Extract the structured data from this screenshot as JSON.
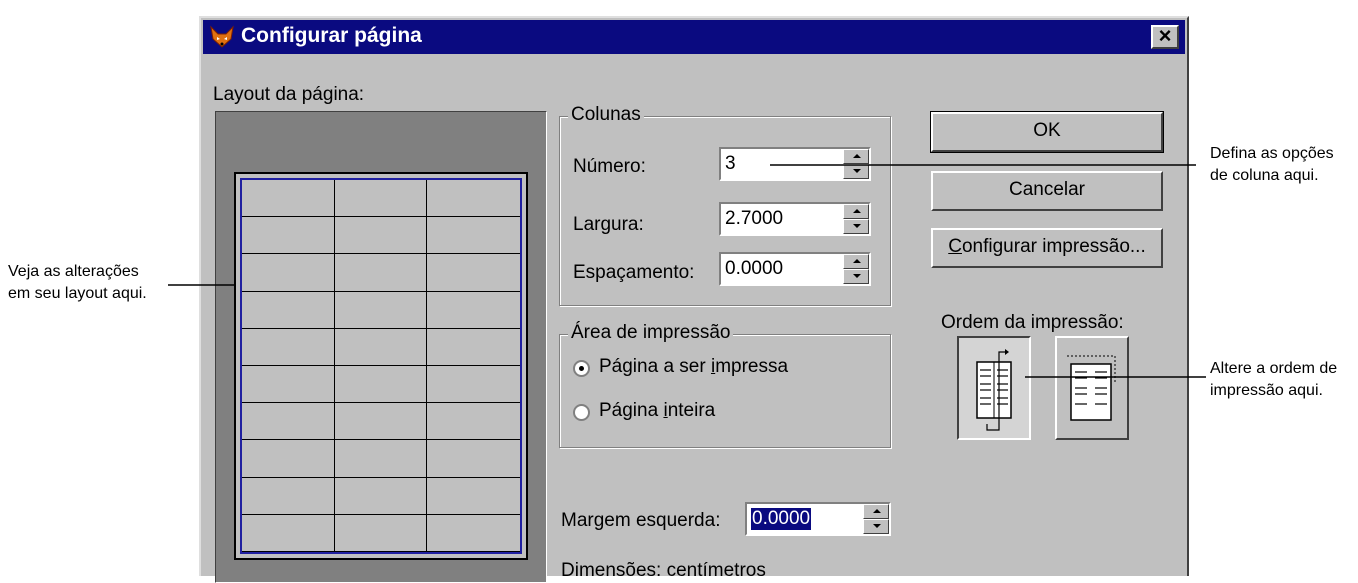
{
  "dialog": {
    "title": "Configurar página",
    "close_symbol": "×",
    "app_icon": "fox-icon"
  },
  "layout": {
    "label": "Layout da página:",
    "grid_rows": 10,
    "grid_cols": 3
  },
  "columns": {
    "group_label": "Colunas",
    "number_label": "Número:",
    "number_value": "3",
    "width_label": "Largura:",
    "width_value": "2.7000",
    "spacing_label": "Espaçamento:",
    "spacing_value": "0.0000"
  },
  "print_area": {
    "group_label": "Área de impressão",
    "option_printable_prefix": "Página a ser ",
    "option_printable_key": "i",
    "option_printable_suffix": "mpressa",
    "option_whole_prefix": "Página ",
    "option_whole_key": "i",
    "option_whole_suffix": "nteira",
    "selected": "printable"
  },
  "left_margin": {
    "label": "Margem esquerda:",
    "value": "0.0000"
  },
  "dimensions_text": "Dimensões: centímetros",
  "buttons": {
    "ok": "OK",
    "cancel": "Cancelar",
    "print_setup_key": "C",
    "print_setup_rest": "onfigurar impressão..."
  },
  "print_order": {
    "label": "Ordem da impressão:",
    "selected": "column-first"
  },
  "callouts": {
    "columns_line1": "Defina as opções",
    "columns_line2": "de coluna aqui.",
    "layout_line1": "Veja as alterações",
    "layout_line2": "em seu layout aqui.",
    "order_line1": "Altere a ordem de",
    "order_line2": "impressão aqui."
  },
  "colors": {
    "titlebar": "#0a0a80",
    "dialog_bg": "#c0c0c0",
    "preview_bg": "#808080",
    "grid_border": "#2020a0",
    "selection": "#0a0a80"
  }
}
